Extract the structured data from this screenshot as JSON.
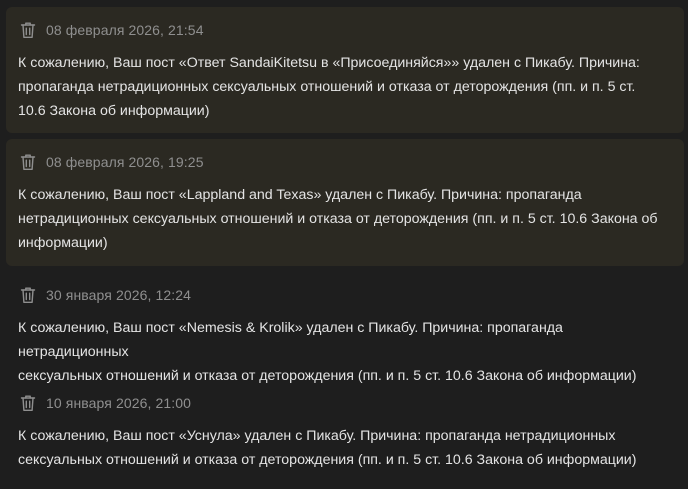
{
  "notifications": [
    {
      "date": "08 февраля 2026, 21:54",
      "icon": "trash-icon",
      "unread": true,
      "lines": [
        "К сожалению, Ваш пост «Ответ SandaiKitetsu в «Присоединяйся»» удален с Пикабу. Причина:",
        "пропаганда нетрадиционных сексуальных отношений и отказа от деторождения (пп. и п. 5 ст.",
        "10.6 Закона об информации)"
      ]
    },
    {
      "date": "08 февраля 2026, 19:25",
      "icon": "trash-icon",
      "unread": true,
      "lines": [
        "К сожалению, Ваш пост «Lappland and Texas» удален с Пикабу. Причина: пропаганда",
        "нетрадиционных сексуальных отношений и отказа от деторождения (пп. и п. 5 ст. 10.6 Закона об",
        "информации)"
      ]
    },
    {
      "date": "30 января 2026, 12:24",
      "icon": "trash-icon",
      "unread": false,
      "lines": [
        "К сожалению, Ваш пост «Nemesis & Krolik» удален с Пикабу. Причина: пропаганда нетрадиционных",
        "сексуальных отношений и отказа от деторождения (пп. и п. 5 ст. 10.6 Закона об информации)"
      ]
    },
    {
      "date": "10 января 2026, 21:00",
      "icon": "trash-icon",
      "unread": false,
      "lines": [
        "К сожалению, Ваш пост «Уснула» удален с Пикабу. Причина: пропаганда нетрадиционных",
        "сексуальных отношений и отказа от деторождения (пп. и п. 5 ст. 10.6 Закона об информации)"
      ]
    }
  ],
  "colors": {
    "background": "#1e1e1e",
    "unread_background": "#2b2922",
    "date_text": "#8f8f8f",
    "body_text": "#e4e4e4"
  }
}
